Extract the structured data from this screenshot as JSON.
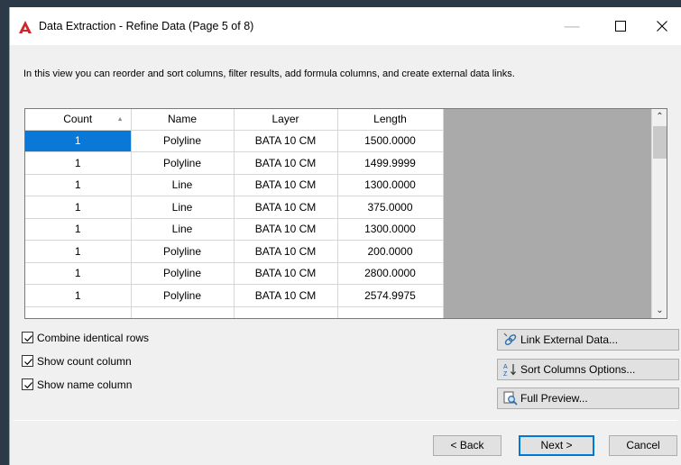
{
  "window": {
    "title": "Data Extraction - Refine Data (Page 5 of 8)",
    "minimize_glyph": "—",
    "accent_color": "#0a78d7"
  },
  "description": "In this view you can reorder and sort columns, filter results, add formula columns, and create external data links.",
  "grid": {
    "columns": [
      "Count",
      "Name",
      "Layer",
      "Length"
    ],
    "sort_indicator": "▲",
    "rows": [
      [
        "1",
        "Polyline",
        "BATA 10 CM",
        "1500.0000"
      ],
      [
        "1",
        "Polyline",
        "BATA 10 CM",
        "1499.9999"
      ],
      [
        "1",
        "Line",
        "BATA 10 CM",
        "1300.0000"
      ],
      [
        "1",
        "Line",
        "BATA 10 CM",
        "375.0000"
      ],
      [
        "1",
        "Line",
        "BATA 10 CM",
        "1300.0000"
      ],
      [
        "1",
        "Polyline",
        "BATA 10 CM",
        "200.0000"
      ],
      [
        "1",
        "Polyline",
        "BATA 10 CM",
        "2800.0000"
      ],
      [
        "1",
        "Polyline",
        "BATA 10 CM",
        "2574.9975"
      ]
    ],
    "selected_cell": "row 1, Count"
  },
  "options": {
    "combine_identical_rows": {
      "label": "Combine identical rows",
      "checked": true
    },
    "show_count_column": {
      "label": "Show count column",
      "checked": true
    },
    "show_name_column": {
      "label": "Show name column",
      "checked": true
    }
  },
  "side_buttons": {
    "link_external": "Link External Data...",
    "sort_columns": "Sort Columns Options...",
    "full_preview": "Full Preview..."
  },
  "footer": {
    "back": "< Back",
    "next": "Next >",
    "cancel": "Cancel"
  }
}
